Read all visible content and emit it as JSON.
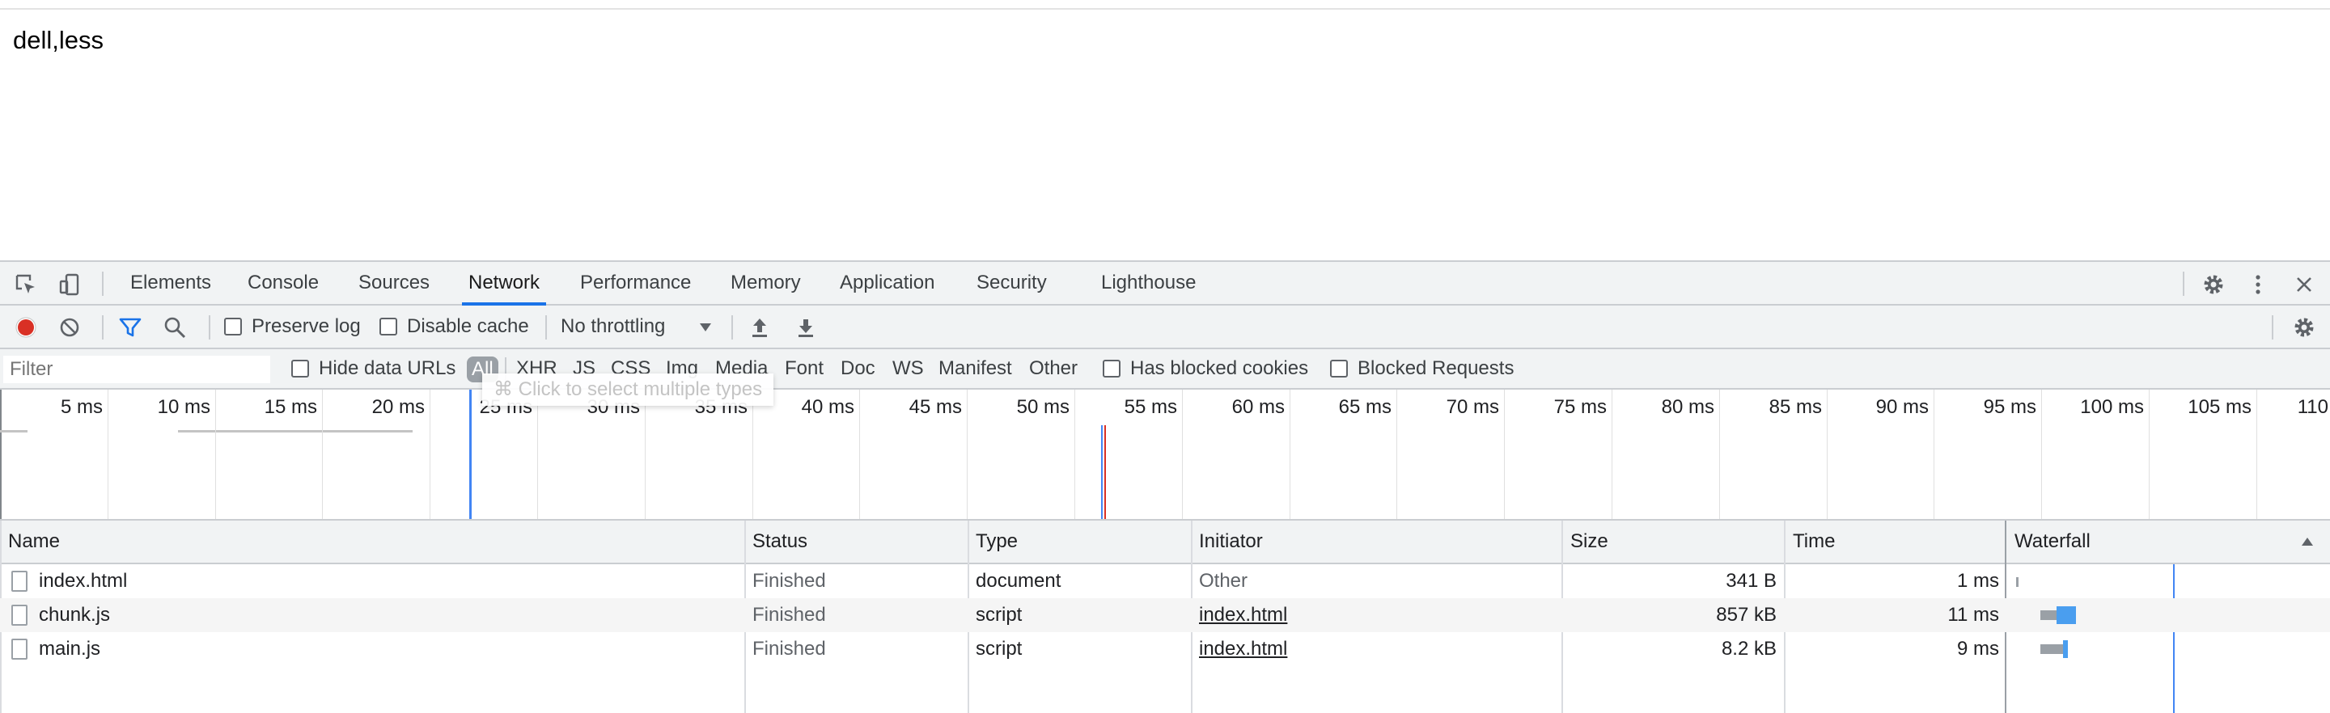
{
  "page": {
    "text": "dell,less"
  },
  "devtools": {
    "tabs": [
      "Elements",
      "Console",
      "Sources",
      "Network",
      "Performance",
      "Memory",
      "Application",
      "Security",
      "Lighthouse"
    ],
    "active_tab": "Network",
    "toolbar": {
      "preserve_log": "Preserve log",
      "disable_cache": "Disable cache",
      "throttling": "No throttling"
    },
    "filter": {
      "placeholder": "Filter",
      "hide_data_urls": "Hide data URLs",
      "types": [
        "All",
        "XHR",
        "JS",
        "CSS",
        "Img",
        "Media",
        "Font",
        "Doc",
        "WS",
        "Manifest",
        "Other"
      ],
      "has_blocked_cookies": "Has blocked cookies",
      "blocked_requests": "Blocked Requests",
      "tooltip": "⌘ Click to select multiple types"
    },
    "overview_ticks": [
      "5 ms",
      "10 ms",
      "15 ms",
      "20 ms",
      "25 ms",
      "30 ms",
      "35 ms",
      "40 ms",
      "45 ms",
      "50 ms",
      "55 ms",
      "60 ms",
      "65 ms",
      "70 ms",
      "75 ms",
      "80 ms",
      "85 ms",
      "90 ms",
      "95 ms",
      "100 ms",
      "105 ms",
      "110"
    ],
    "table": {
      "headers": [
        "Name",
        "Status",
        "Type",
        "Initiator",
        "Size",
        "Time",
        "Waterfall"
      ],
      "rows": [
        {
          "name": "index.html",
          "status": "Finished",
          "type": "document",
          "initiator": "Other",
          "size": "341 B",
          "time": "1 ms"
        },
        {
          "name": "chunk.js",
          "status": "Finished",
          "type": "script",
          "initiator": "index.html",
          "size": "857 kB",
          "time": "11 ms"
        },
        {
          "name": "main.js",
          "status": "Finished",
          "type": "script",
          "initiator": "index.html",
          "size": "8.2 kB",
          "time": "9 ms"
        }
      ]
    },
    "colors": {
      "accent": "#1a73e8",
      "record": "#d93025",
      "waterfall_blue": "#4a9eef"
    }
  }
}
